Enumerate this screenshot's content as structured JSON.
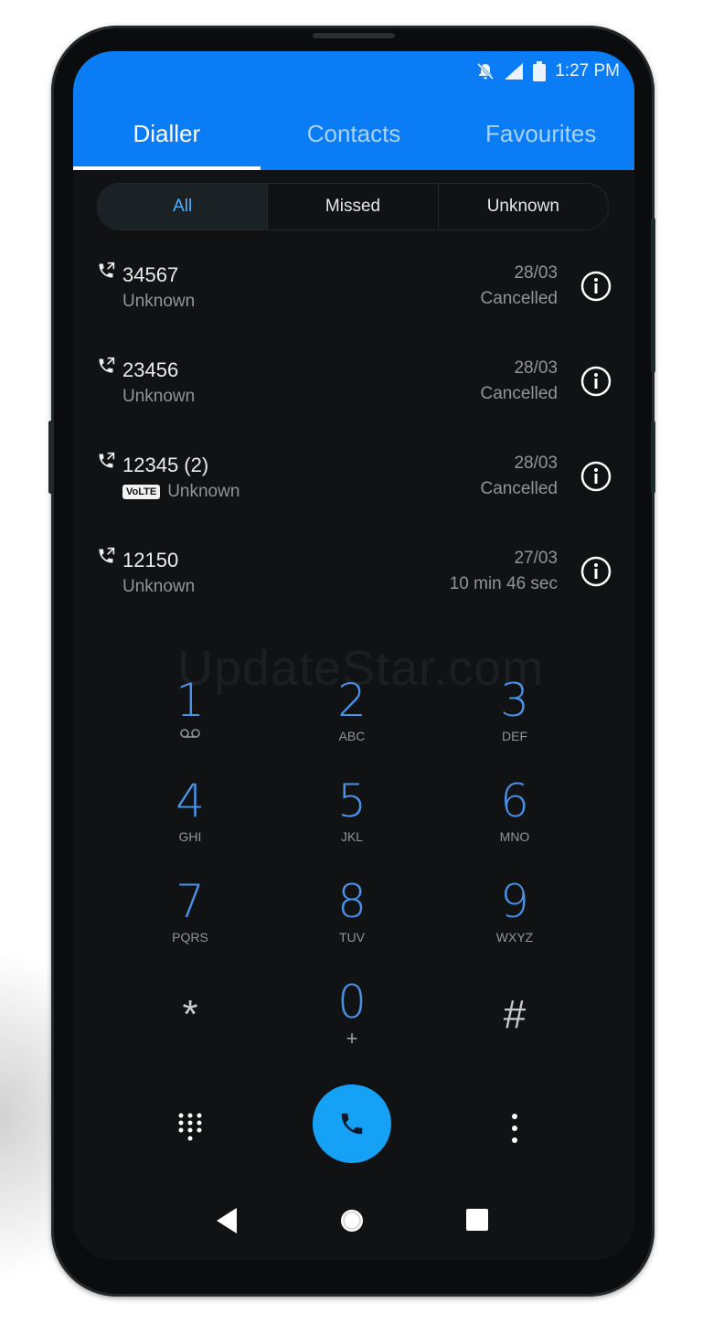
{
  "status_bar": {
    "time": "1:27 PM"
  },
  "tabs": [
    {
      "label": "Dialler",
      "active": true
    },
    {
      "label": "Contacts",
      "active": false
    },
    {
      "label": "Favourites",
      "active": false
    }
  ],
  "filters": [
    {
      "label": "All",
      "active": true
    },
    {
      "label": "Missed",
      "active": false
    },
    {
      "label": "Unknown",
      "active": false
    }
  ],
  "calls": [
    {
      "number": "34567",
      "label": "Unknown",
      "date": "28/03",
      "status": "Cancelled",
      "volte": false
    },
    {
      "number": "23456",
      "label": "Unknown",
      "date": "28/03",
      "status": "Cancelled",
      "volte": false
    },
    {
      "number": "12345 (2)",
      "label": "Unknown",
      "date": "28/03",
      "status": "Cancelled",
      "volte": true,
      "badge": "VoLTE"
    },
    {
      "number": "12150",
      "label": "Unknown",
      "date": "27/03",
      "status": "10 min 46 sec",
      "volte": false
    }
  ],
  "watermark": "UpdateStar.com",
  "keypad": [
    {
      "digit": "1",
      "sub": ""
    },
    {
      "digit": "2",
      "sub": "ABC"
    },
    {
      "digit": "3",
      "sub": "DEF"
    },
    {
      "digit": "4",
      "sub": "GHI"
    },
    {
      "digit": "5",
      "sub": "JKL"
    },
    {
      "digit": "6",
      "sub": "MNO"
    },
    {
      "digit": "7",
      "sub": "PQRS"
    },
    {
      "digit": "8",
      "sub": "TUV"
    },
    {
      "digit": "9",
      "sub": "WXYZ"
    },
    {
      "digit": "*",
      "sub": ""
    },
    {
      "digit": "0",
      "sub": "+"
    },
    {
      "digit": "#",
      "sub": ""
    }
  ],
  "colors": {
    "appbar": "#0a7cf6",
    "accent": "#4db0ff",
    "digit": "#4a92e8",
    "call_button": "#14a1f6",
    "background": "#111214"
  }
}
